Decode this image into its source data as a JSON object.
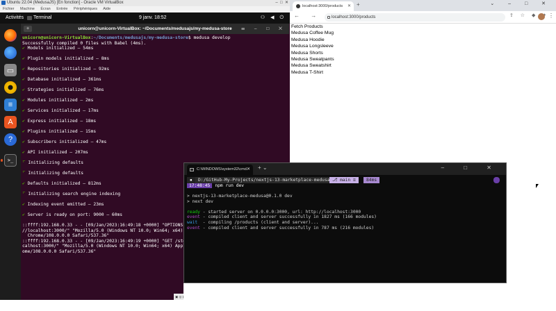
{
  "vbox": {
    "title": "Ubuntu 22.04 (MedusaJS) [En fonction] - Oracle VM VirtualBox",
    "menu": [
      "Fichier",
      "Machine",
      "Écran",
      "Entrée",
      "Périphériques",
      "Aide"
    ],
    "status": "CTRL DROITE"
  },
  "ubuntu": {
    "activities": "Activités",
    "app": "Terminal",
    "clock": "9 janv.  18:52"
  },
  "terminal": {
    "title": "unicorn@unicorn-VirtualBox: ~/Documents/medusajs/my-medusa-store",
    "prompt_user": "unicorn@unicorn-VirtualBox",
    "prompt_path": "~/Documents/medusajs/my-medusa-store",
    "command": "$ medusa develop",
    "compiled": "Successfully compiled 0 files with Babel (4ms).",
    "checks": [
      "Models initialized – 54ms",
      "Plugin models initialized – 8ms",
      "Repositories initialized – 92ms",
      "Database initialized – 361ms",
      "Strategies initialized – 76ms",
      "Modules initialized – 2ms",
      "Services initialized – 17ms",
      "Express initialized – 18ms",
      "Plugins initialized – 15ms",
      "Subscribers initialized – 47ms",
      "API initialized – 207ms"
    ],
    "init_defaults_1": "Initializing defaults",
    "init_defaults_2": "Initializing defaults",
    "defaults_done": "Defaults initialized – 812ms",
    "search_index": "Initializing search engine indexing",
    "indexing": "Indexing event emitted – 23ms",
    "server_ready": "Server is ready on port: 9000 – 60ms",
    "log1": "::ffff:192.168.0.33 - - [09/Jan/2023:16:49:18 +0000] \"OPTIONS",
    "log2": "//localhost:3000/\" \"Mozilla/5.0 (Windows NT 10.0; Win64; x64)",
    "log3": "Chrome/108.0.0.0 Safari/537.36\"",
    "log4": "::ffff:192.168.0.33 - - [09/Jan/2023:16:49:19 +0000] \"GET /sto",
    "log5": "calhost:3000/\" \"Mozilla/5.0 (Windows NT 10.0; Win64; x64) Appl",
    "log6": "ome/108.0.0.0 Safari/537.36\""
  },
  "browser": {
    "tab_title": "localhost:3000/products",
    "url": "localhost:3000/products",
    "fetch_button": "Fetch Products",
    "products": [
      "Medusa Coffee Mug",
      "Medusa Hoodie",
      "Medusa Longsleeve",
      "Medusa Shorts",
      "Medusa Sweatpants",
      "Medusa Sweatshirt",
      "Medusa T-Shirt"
    ]
  },
  "wt": {
    "tab_title": "C:\\WINDOWS\\system32\\cmd.",
    "path": "D:/GitHub-My-Projects/nextjs-13-marketplace-medusa",
    "git": "main ≡",
    "duration": "84ms",
    "time": "17:48:45",
    "cmd": "npm run dev",
    "pkg": "> nextjs-13-marketplace-medusa@0.1.0 dev",
    "next": "> next dev",
    "ready_tag": "ready",
    "ready_msg": " - started server on 0.0.0.0:3000, url: http://localhost:3000",
    "event1_tag": "event",
    "event1_msg": " - compiled client and server successfully in 1827 ms (166 modules)",
    "wait_tag": "wait",
    "wait_msg": "  - compiling /products (client and server)...",
    "event2_tag": "event",
    "event2_msg": " - compiled client and server successfully in 787 ms (216 modules)"
  }
}
